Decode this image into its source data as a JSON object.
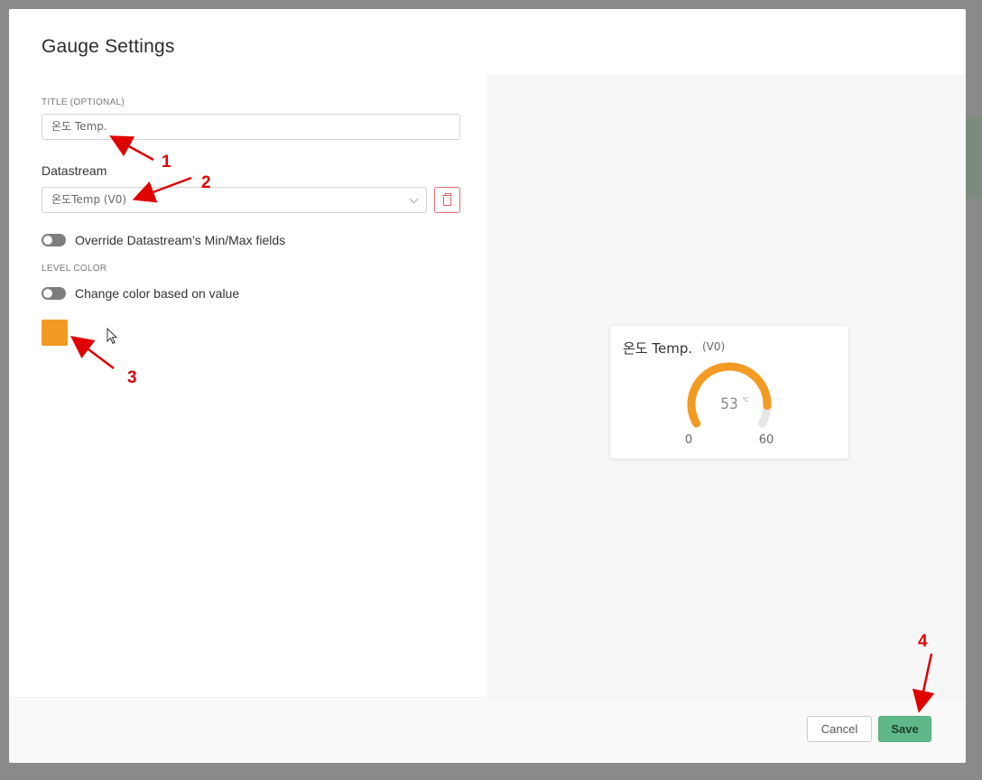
{
  "modal": {
    "title": "Gauge Settings"
  },
  "form": {
    "title_label": "TITLE (OPTIONAL)",
    "title_value": "온도 Temp.",
    "datastream_label": "Datastream",
    "datastream_value": "온도Temp (V0)",
    "override_label": "Override Datastream’s Min/Max fields",
    "override_on": false,
    "level_color_label": "LEVEL COLOR",
    "change_color_label": "Change color based on value",
    "change_color_on": false,
    "swatch_color": "#f39a22"
  },
  "preview": {
    "title": "온도 Temp.",
    "pin": "(V0)",
    "value": "53",
    "unit": "℃",
    "min": "0",
    "max": "60",
    "value_fraction": 0.883,
    "arc_color": "#f39a22",
    "track_color": "#e6e6e6"
  },
  "footer": {
    "cancel_label": "Cancel",
    "save_label": "Save",
    "save_color": "#5eb88a"
  },
  "annotations": [
    "1",
    "2",
    "3",
    "4"
  ]
}
